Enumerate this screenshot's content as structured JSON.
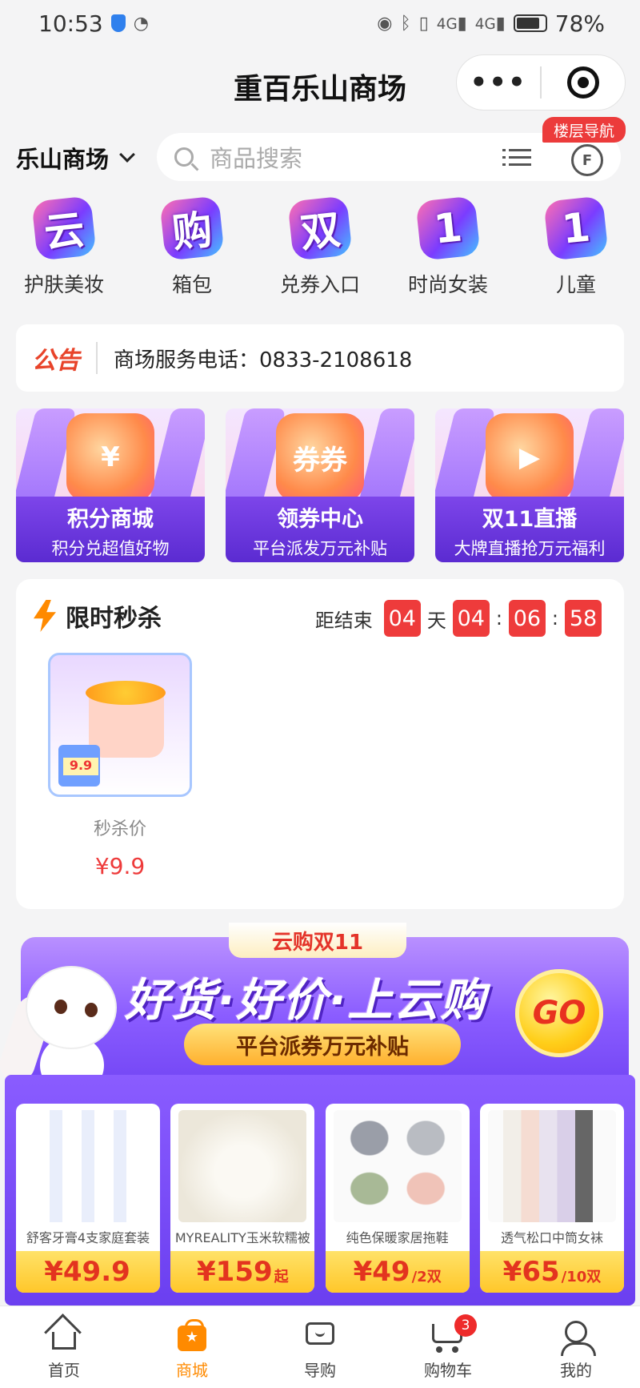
{
  "status_bar": {
    "time": "10:53",
    "battery": "78%",
    "network1": "4G",
    "network2": "4G"
  },
  "navbar": {
    "title": "重百乐山商场",
    "more_icon": "more-dots-icon",
    "close_icon": "target-icon"
  },
  "store_bar": {
    "store_name": "乐山商场",
    "search_placeholder": "商品搜索",
    "floor_nav_label": "楼层导航",
    "floor_btn": "F"
  },
  "categories": [
    {
      "icon_char": "云",
      "label": "护肤美妆"
    },
    {
      "icon_char": "购",
      "label": "箱包"
    },
    {
      "icon_char": "双",
      "label": "兑券入口"
    },
    {
      "icon_char": "1",
      "label": "时尚女装"
    },
    {
      "icon_char": "1",
      "label": "儿童"
    }
  ],
  "notice": {
    "tag": "公告",
    "text": "商场服务电话：0833-2108618"
  },
  "banners": [
    {
      "title": "积分商城",
      "subtitle": "积分兑超值好物",
      "deco": "¥"
    },
    {
      "title": "领券中心",
      "subtitle": "平台派发万元补贴",
      "deco": "券券"
    },
    {
      "title": "双11直播",
      "subtitle": "大牌直播抢万元福利",
      "deco": "▶"
    }
  ],
  "flash_sale": {
    "title": "限时秒杀",
    "countdown_label": "距结束",
    "days": "04",
    "day_unit": "天",
    "hours": "04",
    "minutes": "06",
    "seconds": "58",
    "sep": ":",
    "product": {
      "label": "秒杀价",
      "price": "¥9.9",
      "img_tag": "9.9"
    }
  },
  "promo": {
    "tab": "云购双11",
    "headline": "好货·好价·上云购",
    "pill": "平台派券万元补贴",
    "go": "GO",
    "items": [
      {
        "name": "舒客牙膏4支家庭套装",
        "price": "¥49.9",
        "unit": "",
        "color": "#f3f5fa"
      },
      {
        "name": "MYREALITY玉米软糯被",
        "price": "¥159",
        "unit": "起",
        "color": "#f4f2ec"
      },
      {
        "name": "纯色保暖家居拖鞋",
        "price": "¥49",
        "unit": "/2双",
        "color": "#eef0ea"
      },
      {
        "name": "透气松口中筒女袜",
        "price": "¥65",
        "unit": "/10双",
        "color": "#f2eff4"
      }
    ]
  },
  "tabbar": [
    {
      "label": "首页",
      "icon": "home-icon"
    },
    {
      "label": "商城",
      "icon": "shopping-bag-icon"
    },
    {
      "label": "导购",
      "icon": "guide-chat-icon"
    },
    {
      "label": "购物车",
      "icon": "cart-icon",
      "badge": "3"
    },
    {
      "label": "我的",
      "icon": "profile-icon"
    }
  ]
}
